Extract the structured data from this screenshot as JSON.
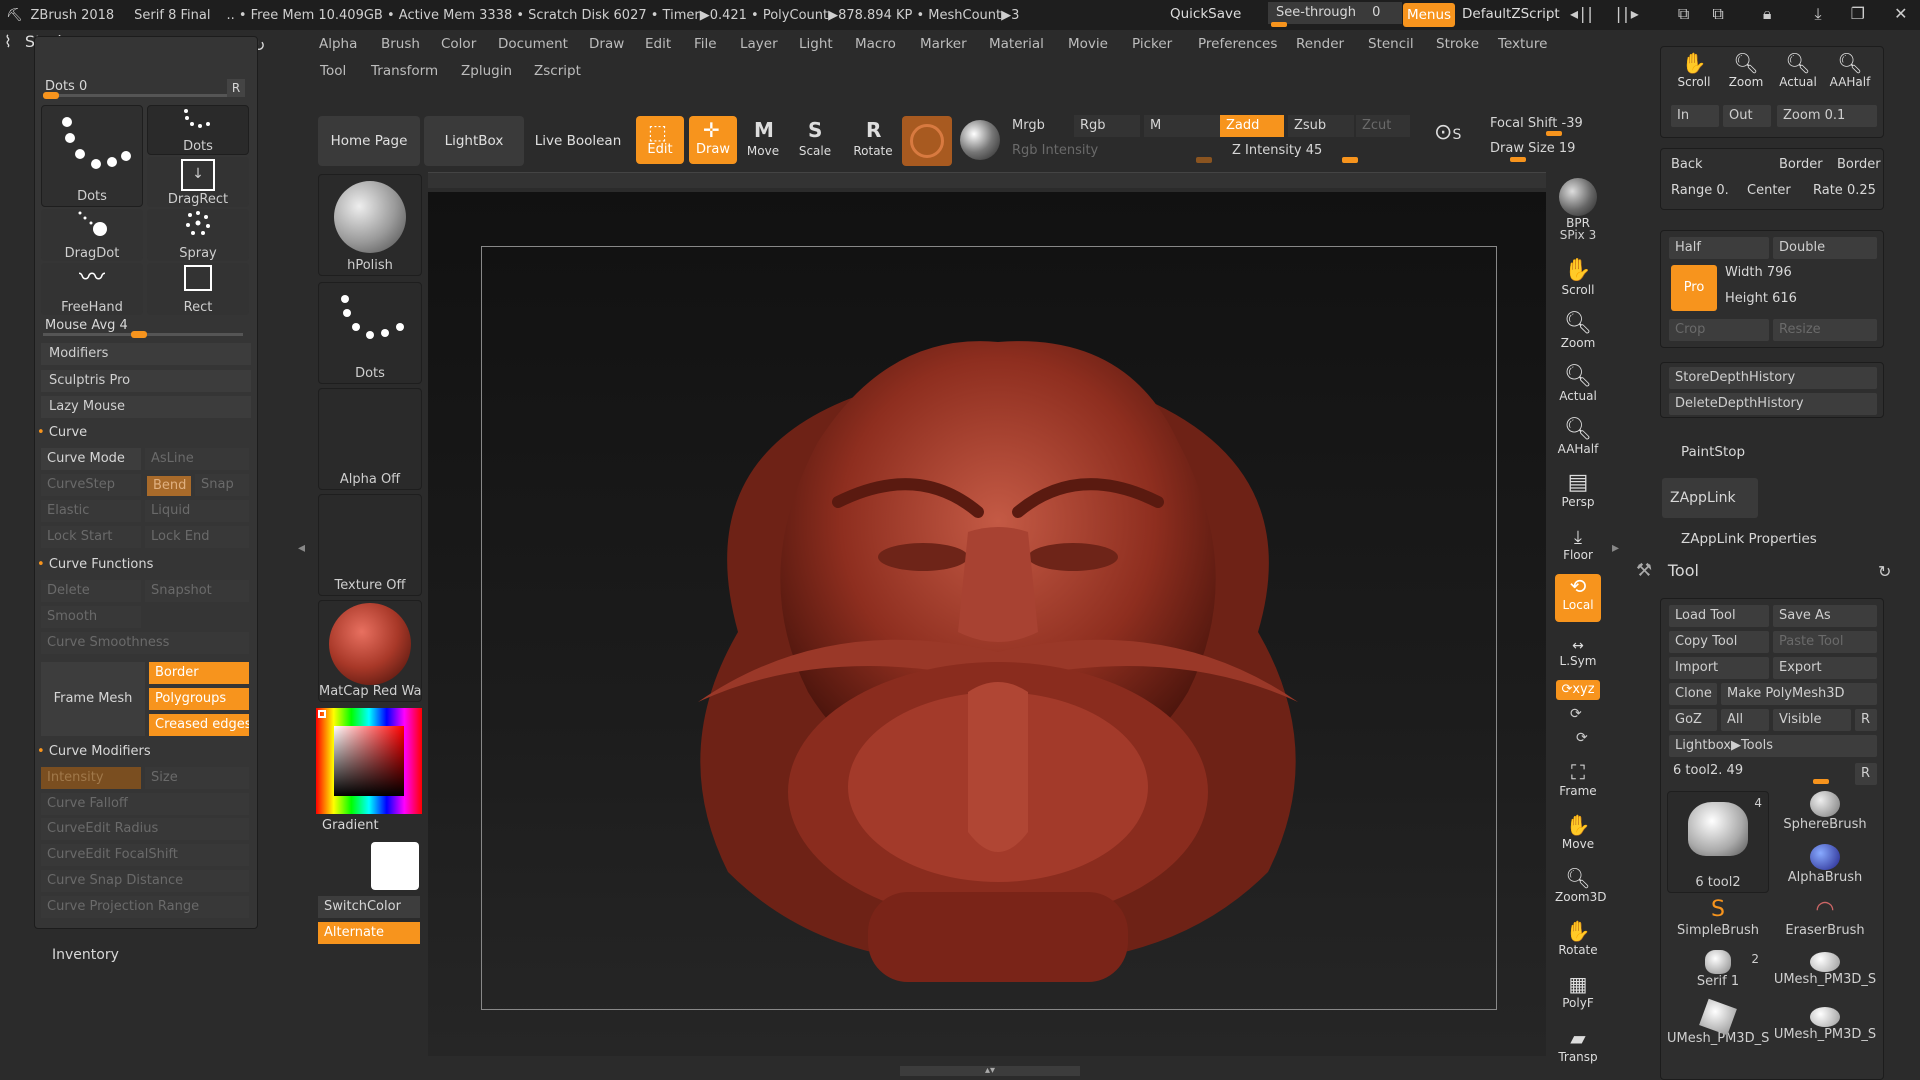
{
  "title": {
    "app": "ZBrush 2018",
    "doc": "Serif 8 Final",
    "stats": ".. • Free Mem 10.409GB • Active Mem 3338 • Scratch Disk 6027 • Timer▶0.421 • PolyCount▶878.894 KP • MeshCount▶3",
    "quicksave": "QuickSave",
    "seethrough": "See-through",
    "seethrough_val": "0",
    "menus": "Menus",
    "script": "DefaultZScript"
  },
  "menu": {
    "row1": [
      "Alpha",
      "Brush",
      "Color",
      "Document",
      "Draw",
      "Edit",
      "File",
      "Layer",
      "Light",
      "Macro",
      "Marker",
      "Material",
      "Movie",
      "Picker",
      "Preferences",
      "Render",
      "Stencil",
      "Stroke",
      "Texture"
    ],
    "row2": [
      "Tool",
      "Transform",
      "Zplugin",
      "Zscript"
    ]
  },
  "stroke": {
    "title": "Stroke",
    "dots": "Dots 0",
    "r": "R",
    "tiles": [
      "Dots",
      "Dots",
      "DragRect",
      "DragDot",
      "Spray",
      "FreeHand",
      "Rect"
    ],
    "mouse_avg": "Mouse Avg 4",
    "items": [
      "Modifiers",
      "Sculptris Pro",
      "Lazy Mouse"
    ],
    "curve": "Curve",
    "curve_mode": "Curve Mode",
    "asline": "AsLine",
    "curvestep": "CurveStep",
    "bend": "Bend",
    "snap": "Snap",
    "elastic": "Elastic",
    "liquid": "Liquid",
    "lockstart": "Lock Start",
    "lockend": "Lock End",
    "curve_functions": "Curve Functions",
    "delete": "Delete",
    "snapshot": "Snapshot",
    "smooth": "Smooth",
    "curve_smoothness": "Curve Smoothness",
    "frame_mesh": "Frame Mesh",
    "border": "Border",
    "polygroups": "Polygroups",
    "creased": "Creased edges",
    "curve_modifiers": "Curve Modifiers",
    "intensity": "Intensity",
    "size": "Size",
    "curve_falloff": "Curve Falloff",
    "curveedit_radius": "CurveEdit Radius",
    "curveedit_focal": "CurveEdit FocalShift",
    "snap_distance": "Curve Snap Distance",
    "proj_range": "Curve Projection Range",
    "inventory": "Inventory"
  },
  "shelf": {
    "brush": "hPolish",
    "stroke": "Dots",
    "alpha": "Alpha Off",
    "texture": "Texture Off",
    "material": "MatCap Red Wa",
    "gradient": "Gradient",
    "switchcolor": "SwitchColor",
    "alternate": "Alternate"
  },
  "toolbar": {
    "home": "Home Page",
    "lightbox": "LightBox",
    "liveboolean": "Live Boolean",
    "edit": "Edit",
    "draw": "Draw",
    "move": "Move",
    "scale": "Scale",
    "rotate": "Rotate",
    "mrgb": "Mrgb",
    "rgb": "Rgb",
    "m": "M",
    "zadd": "Zadd",
    "zsub": "Zsub",
    "zcut": "Zcut",
    "rgb_intensity": "Rgb Intensity",
    "z_intensity": "Z Intensity 45",
    "focal": "Focal Shift -39",
    "drawsize": "Draw Size 19"
  },
  "rightbar": [
    "BPR",
    "SPix 3",
    "Scroll",
    "Zoom",
    "Actual",
    "AAHalf",
    "Persp",
    "Floor",
    "Local",
    "L.Sym",
    "Frame",
    "Move",
    "Zoom3D",
    "Rotate",
    "PolyF",
    "Transp"
  ],
  "right": {
    "nav": [
      "Scroll",
      "Zoom",
      "Actual",
      "AAHalf"
    ],
    "in": "In",
    "out": "Out",
    "zoom": "Zoom 0.1",
    "back": "Back",
    "border1": "Border",
    "border2": "Border",
    "range": "Range 0.",
    "center": "Center",
    "rate": "Rate 0.25",
    "half": "Half",
    "double": "Double",
    "pro": "Pro",
    "width": "Width 796",
    "height": "Height 616",
    "crop": "Crop",
    "resize": "Resize",
    "store": "StoreDepthHistory",
    "deleteh": "DeleteDepthHistory",
    "paintstop": "PaintStop",
    "zapplink": "ZAppLink",
    "zapplink_props": "ZAppLink Properties",
    "tool": "Tool",
    "load": "Load Tool",
    "saveas": "Save As",
    "copy": "Copy Tool",
    "paste": "Paste Tool",
    "import": "Import",
    "export": "Export",
    "clone": "Clone",
    "polymesh": "Make PolyMesh3D",
    "goz": "GoZ",
    "all": "All",
    "visible": "Visible",
    "r": "R",
    "lightbox_tools": "Lightbox▶Tools",
    "tool_slider": "6 tool2. 49",
    "tools": [
      "6 tool2",
      "SphereBrush",
      "AlphaBrush",
      "SimpleBrush",
      "EraserBrush",
      "Serif 1",
      "UMesh_PM3D_S",
      "UMesh_PM3D_S",
      "UMesh_PM3D_S"
    ],
    "tool_count1": "4",
    "tool_count2": "2"
  }
}
